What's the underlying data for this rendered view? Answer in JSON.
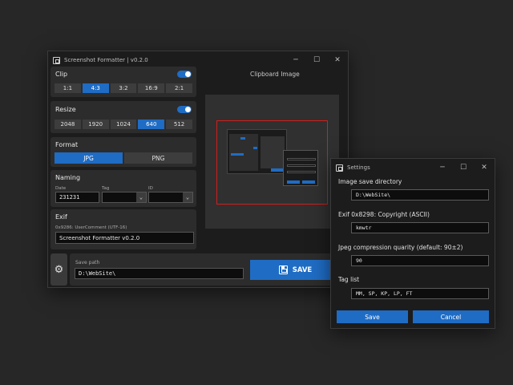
{
  "main": {
    "title": "Screenshot Formatter | v0.2.0",
    "window_controls": {
      "minimize": "─",
      "maximize": "☐",
      "close": "✕"
    },
    "clip": {
      "label": "Clip",
      "enabled": true,
      "options": [
        "1:1",
        "4:3",
        "3:2",
        "16:9",
        "2:1"
      ],
      "selected": "4:3"
    },
    "resize": {
      "label": "Resize",
      "enabled": true,
      "options": [
        "2048",
        "1920",
        "1024",
        "640",
        "512"
      ],
      "selected": "640"
    },
    "format": {
      "label": "Format",
      "options": [
        "JPG",
        "PNG"
      ],
      "selected": "JPG"
    },
    "naming": {
      "label": "Naming",
      "date_label": "Date",
      "date_value": "231231",
      "tag_label": "Tag",
      "tag_value": "",
      "id_label": "ID",
      "id_value": "",
      "dropdown_glyph": "⌄"
    },
    "exif": {
      "label": "Exif",
      "field_label": "0x9286: UserComment (UTF-16)",
      "value": "Screenshot Formatter v0.2.0"
    },
    "save_path": {
      "label": "Save path",
      "value": "D:\\WebSite\\"
    },
    "save_button": "SAVE",
    "gear_glyph": "⚙",
    "clipboard_title": "Clipboard Image"
  },
  "settings": {
    "title": "Settings",
    "window_controls": {
      "minimize": "─",
      "maximize": "☐",
      "close": "✕"
    },
    "image_save_directory": {
      "label": "Image save directory",
      "value": "D:\\WebSite\\"
    },
    "exif_copyright": {
      "label": "Exif 0x8298: Copyright (ASCII)",
      "value": "kmwtr"
    },
    "jpeg_quality": {
      "label": "Jpeg compression quarity (default: 90±2)",
      "value": "90"
    },
    "tag_list": {
      "label": "Tag list",
      "value": "MM, SP, KP, LP, FT"
    },
    "save_label": "Save",
    "cancel_label": "Cancel"
  },
  "colors": {
    "accent": "#1f6cc4",
    "preview_border": "#d11e1e",
    "window_bg": "#1c1c1c",
    "panel_bg": "#2c2c2c",
    "desktop_bg": "#272727"
  }
}
